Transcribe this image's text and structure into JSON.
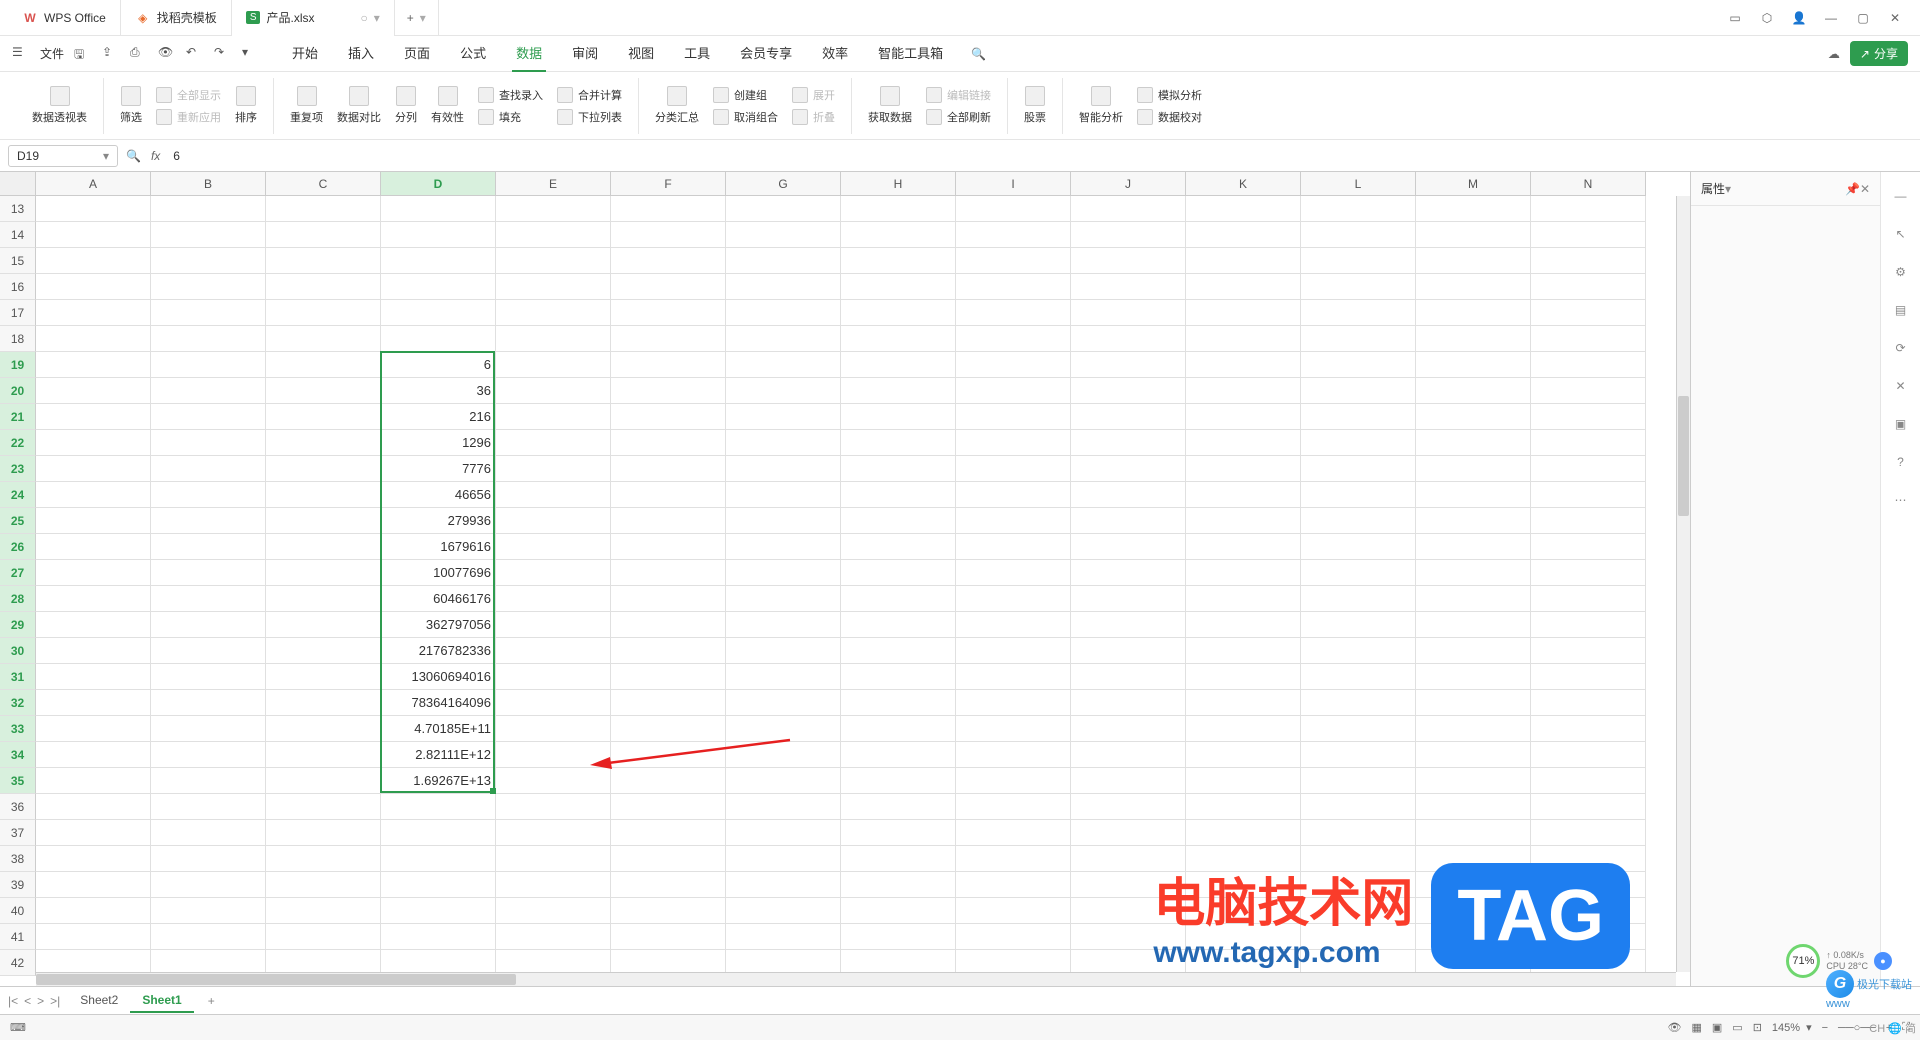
{
  "titlebar": {
    "app_tabs": [
      {
        "label": "WPS Office",
        "color": "#d9534f",
        "glyph": "W"
      },
      {
        "label": "找稻壳模板",
        "color": "#e86a2a",
        "glyph": "◆"
      }
    ],
    "file_tab": {
      "label": "产品.xlsx",
      "badge": "S",
      "badge_bg": "#2e9c4f"
    },
    "add_label": "+"
  },
  "menubar": {
    "file_label": "文件",
    "tabs": [
      "开始",
      "插入",
      "页面",
      "公式",
      "数据",
      "审阅",
      "视图",
      "工具",
      "会员专享",
      "效率",
      "智能工具箱"
    ],
    "active_tab": "数据",
    "share_label": "分享"
  },
  "ribbon": {
    "g1": [
      {
        "label": "数据透视表"
      }
    ],
    "g2_col": [
      {
        "label": "筛选"
      }
    ],
    "g2_rows": [
      {
        "label": "全部显示",
        "disabled": true
      },
      {
        "label": "重新应用",
        "disabled": true
      }
    ],
    "g2_sort": {
      "label": "排序"
    },
    "g3": [
      {
        "label": "重复项"
      },
      {
        "label": "数据对比"
      },
      {
        "label": "分列"
      },
      {
        "label": "有效性"
      }
    ],
    "g3_rows": [
      {
        "label": "查找录入"
      },
      {
        "label": "合并计算"
      },
      {
        "label": "填充"
      },
      {
        "label": "下拉列表"
      }
    ],
    "g4": [
      {
        "label": "分类汇总"
      }
    ],
    "g4_rows": [
      {
        "label": "创建组"
      },
      {
        "label": "取消组合"
      },
      {
        "label": "展开",
        "disabled": true
      },
      {
        "label": "折叠",
        "disabled": true
      }
    ],
    "g5": [
      {
        "label": "获取数据"
      }
    ],
    "g5_rows": [
      {
        "label": "编辑链接",
        "disabled": true
      },
      {
        "label": "全部刷新"
      }
    ],
    "g6": [
      {
        "label": "股票"
      }
    ],
    "g7": [
      {
        "label": "智能分析"
      }
    ],
    "g7_rows": [
      {
        "label": "模拟分析"
      },
      {
        "label": "数据校对"
      }
    ]
  },
  "formula": {
    "cell_ref": "D19",
    "fx_label": "fx",
    "value": "6"
  },
  "grid": {
    "columns": [
      "A",
      "B",
      "C",
      "D",
      "E",
      "F",
      "G",
      "H",
      "I",
      "J",
      "K",
      "L",
      "M",
      "N"
    ],
    "sel_col": "D",
    "row_start": 13,
    "row_end": 42,
    "sel_row_start": 19,
    "sel_row_end": 35,
    "data_col": "D",
    "data": {
      "19": "6",
      "20": "36",
      "21": "216",
      "22": "1296",
      "23": "7776",
      "24": "46656",
      "25": "279936",
      "26": "1679616",
      "27": "10077696",
      "28": "60466176",
      "29": "362797056",
      "30": "2176782336",
      "31": "13060694016",
      "32": "78364164096",
      "33": "4.70185E+11",
      "34": "2.82111E+12",
      "35": "1.69267E+13"
    }
  },
  "props": {
    "title": "属性"
  },
  "sheets": {
    "tabs": [
      "Sheet2",
      "Sheet1"
    ],
    "active": "Sheet1"
  },
  "status": {
    "zoom": "145%",
    "perf_pct": "71%",
    "net": "0.08K/s",
    "cpu": "CPU 28°C",
    "ime": "CH 🌐 简"
  },
  "watermark": {
    "text": "电脑技术网",
    "url": "www.tagxp.com",
    "tag": "TAG",
    "site2_name": "极光下载站",
    "site2_url": "www",
    "g": "G"
  }
}
